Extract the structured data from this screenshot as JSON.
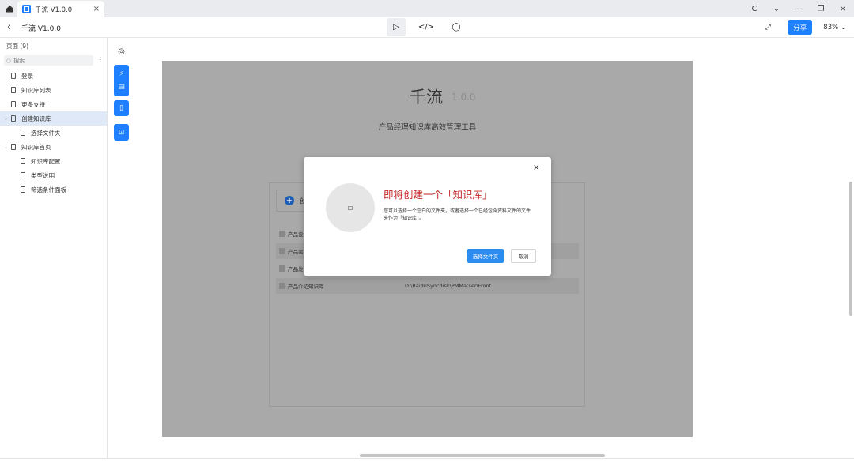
{
  "window": {
    "tab_title": "千流 V1.0.0",
    "tab_close": "×",
    "controls": {
      "reload": "C",
      "dropdown": "⌄",
      "minimize": "—",
      "restore": "❐",
      "close": "×"
    }
  },
  "toolbar": {
    "back": "‹",
    "app_title": "千流 V1.0.0",
    "preview_glyph": "▷",
    "code_glyph": "</>",
    "comment_glyph": "◯",
    "expand_glyph": "⤢",
    "share_label": "分享",
    "zoom": "83% ⌄"
  },
  "sidebar": {
    "pages_header": "页面 (9)",
    "search_placeholder": "搜索",
    "more": "⋮",
    "pages": [
      {
        "label": "登录",
        "level": 0,
        "active": false
      },
      {
        "label": "知识库列表",
        "level": 0,
        "active": false
      },
      {
        "label": "更多支持",
        "level": 0,
        "active": false
      },
      {
        "label": "创建知识库",
        "level": 0,
        "active": true,
        "expanded": true
      },
      {
        "label": "选择文件夹",
        "level": 1,
        "active": false
      },
      {
        "label": "知识库首页",
        "level": 0,
        "active": false,
        "expanded": true
      },
      {
        "label": "知识库配置",
        "level": 1,
        "active": false
      },
      {
        "label": "类型说明",
        "level": 1,
        "active": false
      },
      {
        "label": "筛选条件面板",
        "level": 1,
        "active": false
      }
    ]
  },
  "side_tools": {
    "target_glyph": "◎",
    "lightning_glyph": "⚡",
    "notes_glyph": "▤",
    "device_glyph": "▯",
    "device2_glyph": "⊡"
  },
  "artboard": {
    "brand": "千流",
    "version": "1.0.0",
    "subtitle": "产品经理知识库高效管理工具",
    "create_label": "创",
    "libraries": [
      {
        "name": "产品设",
        "path": ""
      },
      {
        "name": "产品需",
        "path": ""
      },
      {
        "name": "产品发",
        "path": ""
      },
      {
        "name": "产品介绍知识库",
        "path": "D:\\BaiduSyncdisk\\PMMatser\\Front"
      }
    ]
  },
  "modal": {
    "close": "×",
    "title": "即将创建一个「知识库」",
    "description": "您可以选择一个空白的文件夹，或者选择一个已经包含资料文件的文件夹作为「知识库」。",
    "primary_label": "选择文件夹",
    "cancel_label": "取消"
  },
  "colors": {
    "accent": "#1e80ff",
    "modal_title": "#c62828",
    "overlay": "#a9a9a9",
    "active_page": "#dfe9f7"
  }
}
